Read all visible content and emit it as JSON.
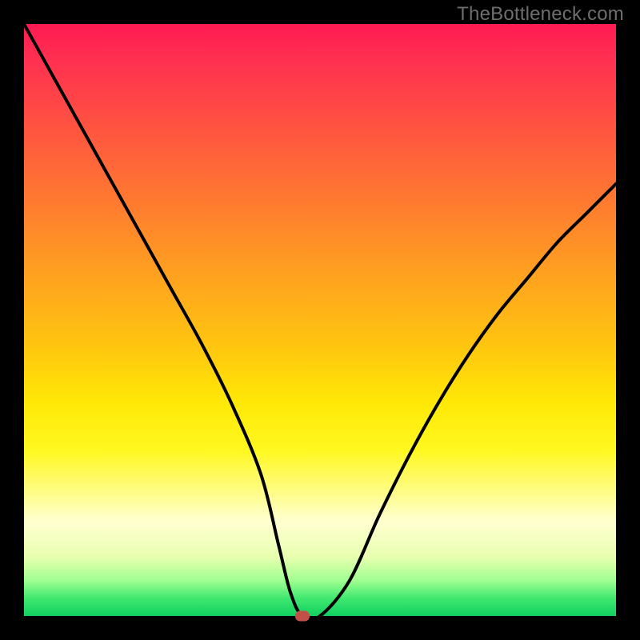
{
  "watermark": "TheBottleneck.com",
  "chart_data": {
    "type": "line",
    "title": "",
    "xlabel": "",
    "ylabel": "",
    "xlim": [
      0,
      100
    ],
    "ylim": [
      0,
      100
    ],
    "grid": false,
    "series": [
      {
        "name": "curve",
        "x": [
          0,
          5,
          10,
          15,
          20,
          25,
          30,
          35,
          40,
          43,
          45,
          47,
          50,
          55,
          60,
          65,
          70,
          75,
          80,
          85,
          90,
          95,
          100
        ],
        "values": [
          100,
          91,
          82,
          73,
          64,
          55,
          46,
          36,
          24,
          12,
          4,
          0,
          0,
          6,
          17,
          27,
          36,
          44,
          51,
          57,
          63,
          68,
          73
        ]
      }
    ],
    "marker": {
      "x": 47,
      "y": 0,
      "color": "#c05048"
    },
    "background_gradient": [
      {
        "pos": 0,
        "color": "#ff1a52"
      },
      {
        "pos": 50,
        "color": "#ffc010"
      },
      {
        "pos": 85,
        "color": "#ffffc0"
      },
      {
        "pos": 100,
        "color": "#10d060"
      }
    ]
  }
}
